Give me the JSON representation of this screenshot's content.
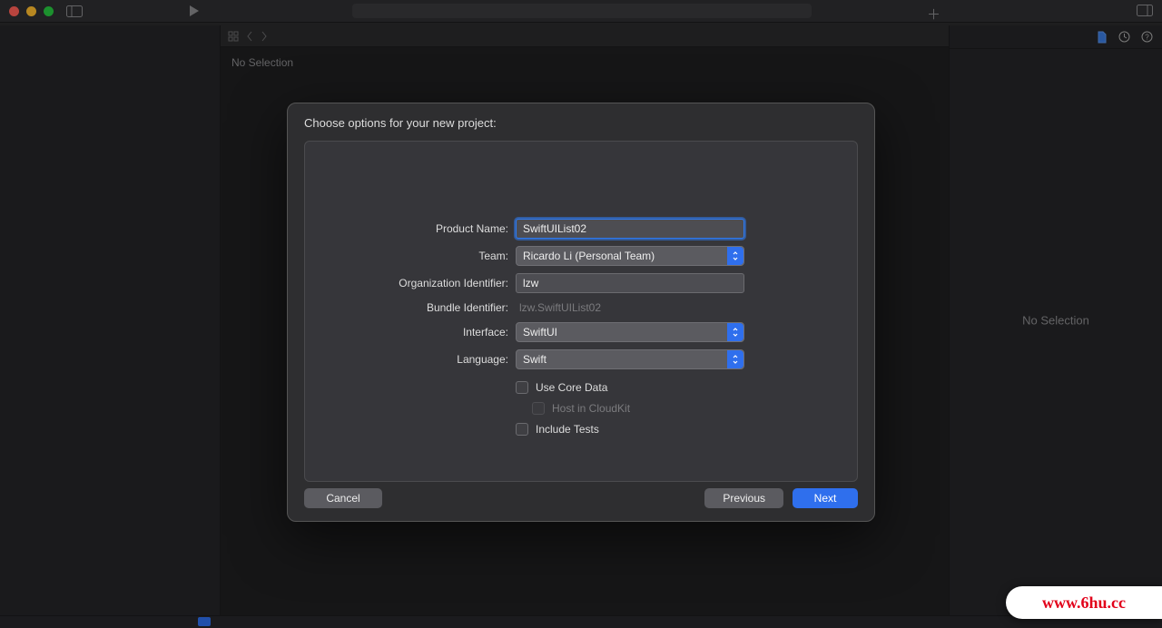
{
  "header": {
    "no_selection": "No Selection"
  },
  "inspector": {
    "no_selection": "No Selection"
  },
  "dialog": {
    "title": "Choose options for your new project:",
    "labels": {
      "product_name": "Product Name:",
      "team": "Team:",
      "org_identifier": "Organization Identifier:",
      "bundle_identifier": "Bundle Identifier:",
      "interface": "Interface:",
      "language": "Language:"
    },
    "values": {
      "product_name": "SwiftUIList02",
      "team": "Ricardo Li (Personal Team)",
      "org_identifier": "lzw",
      "bundle_identifier": "lzw.SwiftUIList02",
      "interface": "SwiftUI",
      "language": "Swift"
    },
    "checks": {
      "core_data": "Use Core Data",
      "cloudkit": "Host in CloudKit",
      "include_tests": "Include Tests"
    },
    "buttons": {
      "cancel": "Cancel",
      "previous": "Previous",
      "next": "Next"
    }
  },
  "watermark": "www.6hu.cc"
}
